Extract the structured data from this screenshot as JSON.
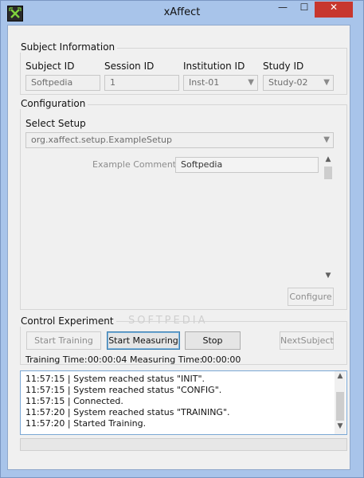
{
  "window": {
    "title": "xAffect",
    "min_glyph": "—",
    "max_glyph": "☐",
    "close_glyph": "✕"
  },
  "subject": {
    "group_title": "Subject Information",
    "subject_id_label": "Subject ID",
    "session_id_label": "Session ID",
    "institution_id_label": "Institution ID",
    "study_id_label": "Study ID",
    "subject_id_value": "Softpedia",
    "session_id_value": "1",
    "institution_id_value": "Inst-01",
    "study_id_value": "Study-02"
  },
  "config": {
    "group_title": "Configuration",
    "select_setup_label": "Select Setup",
    "setup_value": "org.xaffect.setup.ExampleSetup",
    "comment_label": "Example Comment:",
    "comment_value": "Softpedia",
    "configure_button": "Configure"
  },
  "control": {
    "group_title": "Control Experiment",
    "start_training_button": "Start Training",
    "start_measuring_button": "Start Measuring",
    "stop_button": "Stop",
    "next_subject_button": "NextSubject",
    "training_time_label": "Training Time:",
    "training_time_value": "00:00:04",
    "measuring_time_label": "Measuring Time:",
    "measuring_time_value": "00:00:00"
  },
  "log": {
    "lines": [
      "11:57:15 | System reached status \"INIT\".",
      "11:57:15 | System reached status \"CONFIG\".",
      "11:57:15 | Connected.",
      "11:57:20 | System reached status \"TRAINING\".",
      "11:57:20 | Started Training."
    ]
  },
  "watermark": "SOFTPEDIA",
  "colors": {
    "titlebar": "#a8c4ea",
    "close_button": "#c7372e",
    "log_border": "#7aa7d4"
  }
}
